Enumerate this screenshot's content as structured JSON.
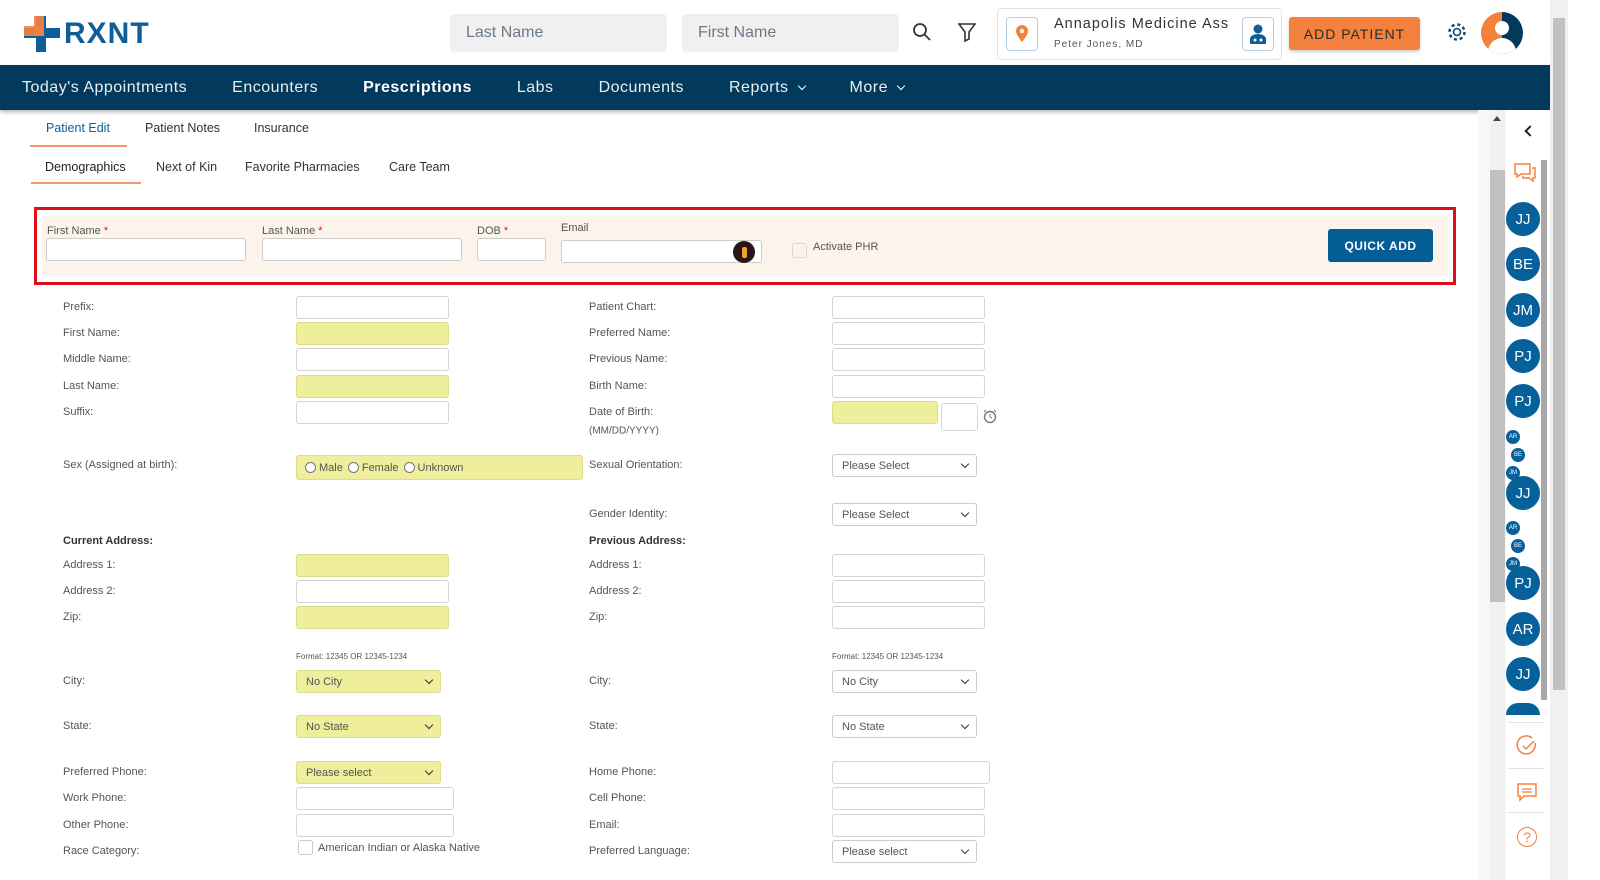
{
  "header": {
    "logo": "RXNT",
    "last_name_placeholder": "Last Name",
    "first_name_placeholder": "First Name",
    "location": "Annapolis Medicine Ass",
    "provider": "Peter Jones, MD",
    "add_patient": "ADD PATIENT"
  },
  "nav": [
    "Today's Appointments",
    "Encounters",
    "Prescriptions",
    "Labs",
    "Documents",
    "Reports",
    "More"
  ],
  "tabs": [
    "Patient Edit",
    "Patient Notes",
    "Insurance"
  ],
  "subtabs": [
    "Demographics",
    "Next of Kin",
    "Favorite Pharmacies",
    "Care Team"
  ],
  "quick_add": {
    "first_name": "First Name",
    "last_name": "Last Name",
    "dob": "DOB",
    "required": "*",
    "email": "Email",
    "activate_phr": "Activate PHR",
    "button": "QUICK ADD"
  },
  "left": {
    "prefix": "Prefix:",
    "first_name": "First Name:",
    "middle_name": "Middle Name:",
    "last_name": "Last Name:",
    "suffix": "Suffix:",
    "sex": "Sex (Assigned at birth):",
    "sex_options": [
      "Male",
      "Female",
      "Unknown"
    ],
    "current_address": "Current Address:",
    "address1": "Address 1:",
    "address2": "Address 2:",
    "zip": "Zip:",
    "zip_format": "Format: 12345 OR 12345-1234",
    "city": "City:",
    "city_value": "No City",
    "state": "State:",
    "state_value": "No State",
    "preferred_phone": "Preferred Phone:",
    "preferred_phone_value": "Please select",
    "work_phone": "Work Phone:",
    "other_phone": "Other Phone:",
    "race_category": "Race Category:",
    "race_option": "American Indian or Alaska Native"
  },
  "right": {
    "patient_chart": "Patient Chart:",
    "preferred_name": "Preferred Name:",
    "previous_name": "Previous Name:",
    "birth_name": "Birth Name:",
    "dob": "Date of Birth:",
    "dob_format": "(MM/DD/YYYY)",
    "sexual_orientation": "Sexual Orientation:",
    "sexual_orientation_value": "Please Select",
    "gender_identity": "Gender Identity:",
    "gender_identity_value": "Please Select",
    "previous_address": "Previous Address:",
    "address1": "Address 1:",
    "address2": "Address 2:",
    "zip": "Zip:",
    "zip_format": "Format: 12345 OR 12345-1234",
    "city": "City:",
    "city_value": "No City",
    "state": "State:",
    "state_value": "No State",
    "home_phone": "Home Phone:",
    "cell_phone": "Cell Phone:",
    "email": "Email:",
    "preferred_language": "Preferred Language:",
    "preferred_language_value": "Please select"
  },
  "panel": {
    "avatars": [
      "JJ",
      "BE",
      "JM",
      "PJ",
      "PJ"
    ],
    "group1": [
      "AR",
      "BE",
      "JM"
    ],
    "avatar6": "JJ",
    "group2": [
      "AR",
      "BE",
      "JM"
    ],
    "avatars2": [
      "PJ",
      "AR",
      "JJ"
    ]
  },
  "colors": {
    "nav": "#033a5b",
    "accent": "#f5813f",
    "primary": "#055d96",
    "required_highlight": "#eeee9c"
  }
}
